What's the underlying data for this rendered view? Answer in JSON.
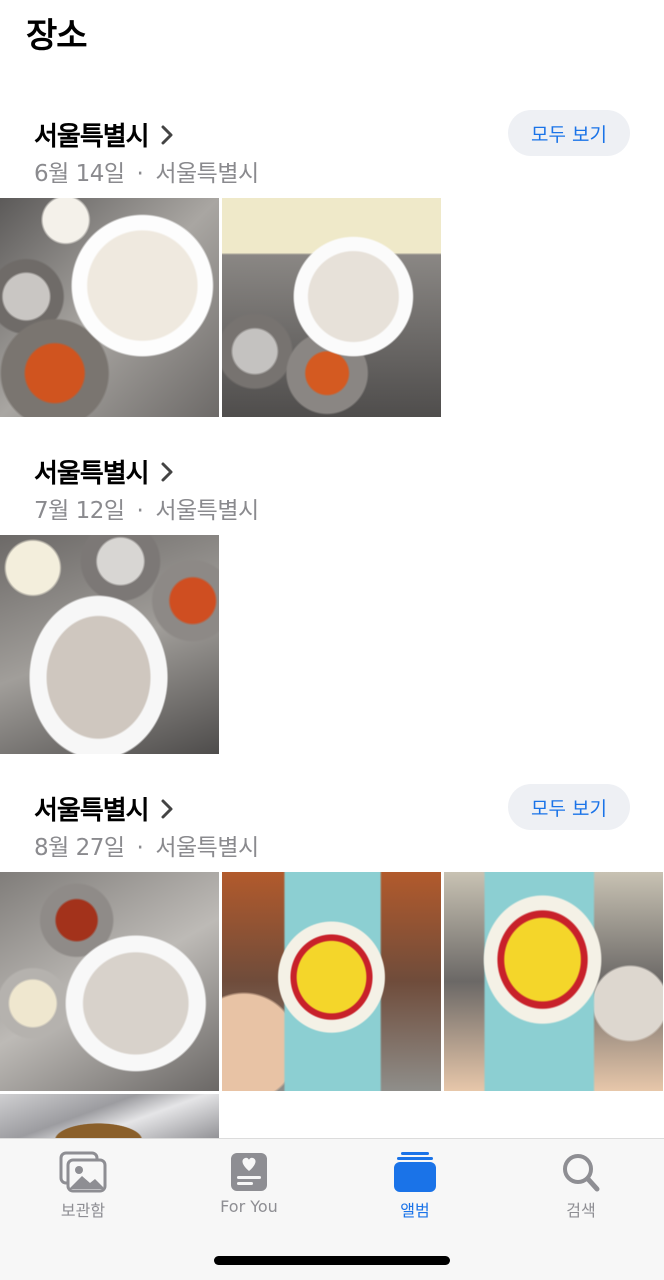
{
  "page": {
    "title": "장소"
  },
  "sections": [
    {
      "title": "서울특별시",
      "date": "6월 14일",
      "dot": "·",
      "place": "서울특별시",
      "see_all": "모두 보기"
    },
    {
      "title": "서울특별시",
      "date": "7월 12일",
      "dot": "·",
      "place": "서울특별시"
    },
    {
      "title": "서울특별시",
      "date": "8월 27일",
      "dot": "·",
      "place": "서울특별시",
      "see_all": "모두 보기"
    }
  ],
  "tabbar": {
    "tabs": [
      {
        "label": "보관함",
        "icon": "photo-library-icon"
      },
      {
        "label": "For You",
        "icon": "for-you-icon"
      },
      {
        "label": "앨범",
        "icon": "albums-icon",
        "active": true
      },
      {
        "label": "검색",
        "icon": "search-icon"
      }
    ]
  },
  "colors": {
    "accent": "#1a73e8",
    "secondary_text": "#8a8a8e"
  }
}
